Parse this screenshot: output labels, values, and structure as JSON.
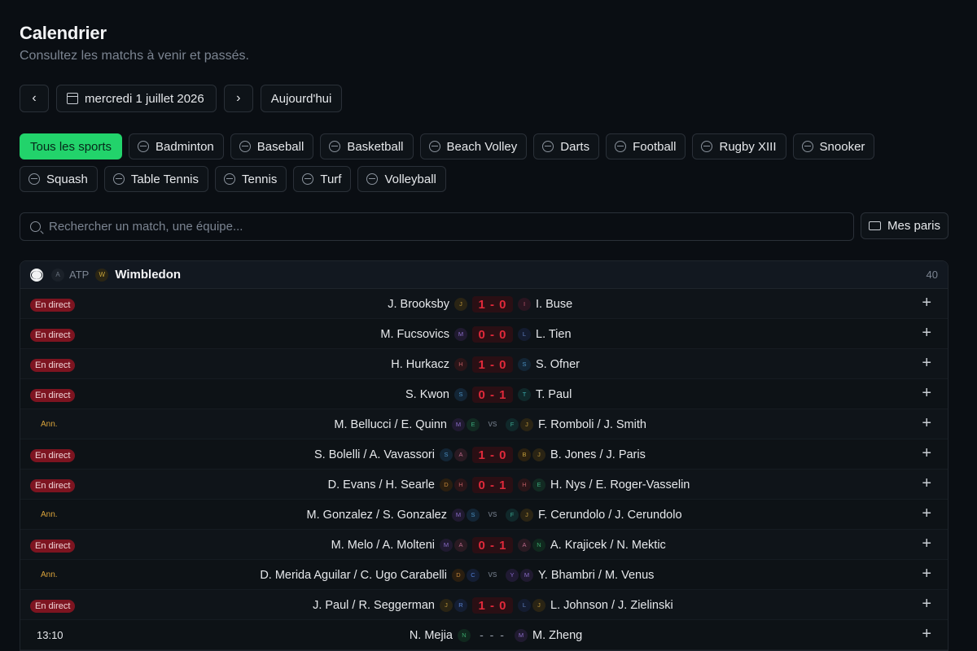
{
  "header": {
    "title": "Calendrier",
    "subtitle": "Consultez les matchs à venir et passés."
  },
  "datebar": {
    "prev_icon": "chevron-left-icon",
    "date_label": "mercredi 1 juillet 2026",
    "next_icon": "chevron-right-icon",
    "today_label": "Aujourd'hui"
  },
  "sports": [
    {
      "label": "Tous les sports",
      "active": true
    },
    {
      "label": "Badminton"
    },
    {
      "label": "Baseball"
    },
    {
      "label": "Basketball"
    },
    {
      "label": "Beach Volley"
    },
    {
      "label": "Darts"
    },
    {
      "label": "Football"
    },
    {
      "label": "Rugby XIII"
    },
    {
      "label": "Snooker"
    },
    {
      "label": "Squash"
    },
    {
      "label": "Table Tennis"
    },
    {
      "label": "Tennis"
    },
    {
      "label": "Turf"
    },
    {
      "label": "Volleyball"
    }
  ],
  "search": {
    "placeholder": "Rechercher un match, une équipe..."
  },
  "bets_button": {
    "label": "Mes paris"
  },
  "competition": {
    "tour_initial": "A",
    "tour": "ATP",
    "name_initial": "W",
    "name": "Wimbledon",
    "count": "40"
  },
  "colors": {
    "accent": "#22d36b",
    "live_badge": "#7d1420",
    "score_red": "#e0293a",
    "cancelled": "#d9a33b"
  },
  "matches": [
    {
      "status": "En direct",
      "type": "live",
      "home": "J. Brooksby",
      "home_av": [
        "J"
      ],
      "score": "1 - 0",
      "away": "I. Buse",
      "away_av": [
        "I"
      ]
    },
    {
      "status": "En direct",
      "type": "live",
      "home": "M. Fucsovics",
      "home_av": [
        "M"
      ],
      "score": "0 - 0",
      "away": "L. Tien",
      "away_av": [
        "L"
      ]
    },
    {
      "status": "En direct",
      "type": "live",
      "home": "H. Hurkacz",
      "home_av": [
        "H"
      ],
      "score": "1 - 0",
      "away": "S. Ofner",
      "away_av": [
        "S"
      ]
    },
    {
      "status": "En direct",
      "type": "live",
      "home": "S. Kwon",
      "home_av": [
        "S"
      ],
      "score": "0 - 1",
      "away": "T. Paul",
      "away_av": [
        "T"
      ]
    },
    {
      "status": "Ann.",
      "type": "ann",
      "home": "M. Bellucci / E. Quinn",
      "home_av": [
        "M",
        "E"
      ],
      "score": "vs",
      "away": "F. Romboli / J. Smith",
      "away_av": [
        "F",
        "J"
      ]
    },
    {
      "status": "En direct",
      "type": "live",
      "home": "S. Bolelli / A. Vavassori",
      "home_av": [
        "S",
        "A"
      ],
      "score": "1 - 0",
      "away": "B. Jones / J. Paris",
      "away_av": [
        "B",
        "J"
      ]
    },
    {
      "status": "En direct",
      "type": "live",
      "home": "D. Evans / H. Searle",
      "home_av": [
        "D",
        "H"
      ],
      "score": "0 - 1",
      "away": "H. Nys / E. Roger-Vasselin",
      "away_av": [
        "H",
        "E"
      ]
    },
    {
      "status": "Ann.",
      "type": "ann",
      "home": "M. Gonzalez / S. Gonzalez",
      "home_av": [
        "M",
        "S"
      ],
      "score": "vs",
      "away": "F. Cerundolo / J. Cerundolo",
      "away_av": [
        "F",
        "J"
      ]
    },
    {
      "status": "En direct",
      "type": "live",
      "home": "M. Melo / A. Molteni",
      "home_av": [
        "M",
        "A"
      ],
      "score": "0 - 1",
      "away": "A. Krajicek / N. Mektic",
      "away_av": [
        "A",
        "N"
      ]
    },
    {
      "status": "Ann.",
      "type": "ann",
      "home": "D. Merida Aguilar / C. Ugo Carabelli",
      "home_av": [
        "D",
        "C"
      ],
      "score": "vs",
      "away": "Y. Bhambri / M. Venus",
      "away_av": [
        "Y",
        "M"
      ]
    },
    {
      "status": "En direct",
      "type": "live",
      "home": "J. Paul / R. Seggerman",
      "home_av": [
        "J",
        "R"
      ],
      "score": "1 - 0",
      "away": "L. Johnson / J. Zielinski",
      "away_av": [
        "L",
        "J"
      ]
    },
    {
      "status": "13:10",
      "type": "time",
      "home": "N. Mejia",
      "home_av": [
        "N"
      ],
      "score": "- - -",
      "away": "M. Zheng",
      "away_av": [
        "M"
      ]
    }
  ]
}
